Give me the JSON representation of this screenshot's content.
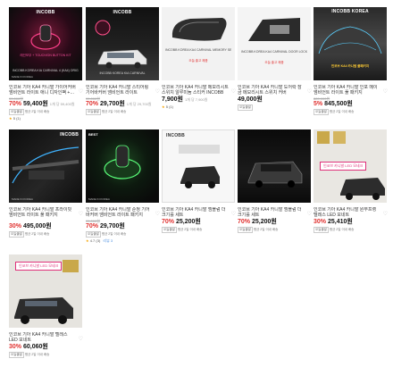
{
  "products": [
    {
      "logo": "INCOBB",
      "banner": "INCOBB KOREA KIA CARNIVAL 4 (KA4) ORIGINAL DESIGN GROUNDS PATTERN AMBIENT LIGHT",
      "highlight": "레인보우 + TOUCH/ON BUTTON KIT",
      "made": "MADE IN KOREA",
      "title": "인코브 기아 KA4 카니발 가이어커버 앰비언트 라이트 애니 디자인팩 +…",
      "original": "99,000원",
      "discount": "70%",
      "price": "59,400",
      "unit": "원",
      "unit_price": "1개 당 59,400원",
      "tag": "오늘출발",
      "shipping": "평균 2일 이내 배송",
      "rating": "5",
      "reviews": "(1)",
      "badge": ""
    },
    {
      "logo": "INCOBB",
      "banner": "INCOBB KOREA KIA CARNIVAL",
      "highlight": "",
      "made": "",
      "title": "인코브 기아 KA4 카니발 스티어링 기어바커버 앰비언트 라이트",
      "original": "99,000원",
      "discount": "70%",
      "price": "29,700",
      "unit": "원",
      "unit_price": "1개 당 29,700원",
      "tag": "오늘출발",
      "shipping": "평균 2일 이내 배송",
      "rating": "",
      "reviews": "",
      "badge": ""
    },
    {
      "logo": "",
      "banner": "INCOBB KOREA KA4 CARNIVAL MEMORY SEAT SWITCH COVER",
      "highlight": "오늘 출고 제품",
      "made": "",
      "title": "인코브 기아 KA4 카니발 메모리시트 스위치 알루미늄 스티커 INCOBB KOREA -…",
      "original": "",
      "discount": "",
      "price": "7,900",
      "unit": "원",
      "unit_price": "1개 당 7,900원",
      "tag": "",
      "shipping": "",
      "rating": "5",
      "reviews": "(1)",
      "badge": ""
    },
    {
      "logo": "",
      "banner": "INCOBB KOREA KA4 CARNIVAL DOOR LOCK SWITCH COVER",
      "highlight": "오늘 출고 제품",
      "made": "",
      "title": "인코브 기아 KA4 카니발 도어락 잠금 메모리시트 스위치 커버 INCOBB…",
      "original": "",
      "discount": "",
      "price": "49,000",
      "unit": "원",
      "unit_price": "",
      "tag": "오늘출발",
      "shipping": "",
      "rating": "",
      "reviews": "",
      "badge": ""
    },
    {
      "logo": "INCOBB KOREA",
      "banner": "인코브 KA4 카니발 풀패키지",
      "highlight": "인코브 KA4 카니발 풀패키지",
      "made": "",
      "title": "인코브 기아 KA4 카니발 인포 메이 앰비언트 라이트 풀 패키지",
      "original": "889,000원",
      "discount": "5%",
      "price": "845,500",
      "unit": "원",
      "unit_price": "",
      "tag": "오늘출발",
      "shipping": "평균 2일 이내 배송",
      "rating": "",
      "reviews": "",
      "badge": ""
    },
    {
      "logo": "INCOBB",
      "banner": "",
      "highlight": "",
      "made": "MADE IN KOREA",
      "title": "인코브 기아 KA4 카니발 프라이빗 앰비언트 라이트 풀 패키지",
      "original": "",
      "discount": "30%",
      "price": "495,000",
      "unit": "원",
      "unit_price": "",
      "tag": "오늘출발",
      "shipping": "평균 2일 이내 배송",
      "rating": "",
      "reviews": "",
      "badge": ""
    },
    {
      "logo": "",
      "banner": "",
      "highlight": "",
      "made": "MADE IN KOREA",
      "title": "인코브 기아 KA4 카니발 순정 기어바커버 앰비언트 라이트 패키지",
      "original": "99,000원",
      "discount": "70%",
      "price": "29,700",
      "unit": "원",
      "unit_price": "",
      "tag": "오늘출발",
      "shipping": "평균 2일 이내 배송",
      "rating": "4.7",
      "reviews": "(3)",
      "badge": "리뷰 3"
    },
    {
      "logo": "INCOBB",
      "banner": "",
      "highlight": "",
      "made": "",
      "title": "인코브 기아 KA4 카니발 엠블럼 더크기를 세트",
      "original": "",
      "discount": "70%",
      "price": "25,200",
      "unit": "원",
      "unit_price": "",
      "tag": "오늘출발",
      "shipping": "평균 2일 이내 배송",
      "rating": "",
      "reviews": "",
      "badge": ""
    },
    {
      "logo": "",
      "banner": "",
      "highlight": "",
      "made": "",
      "title": "인코브 기아 KA4 카니발 엠블럼 더크기를 세트",
      "original": "",
      "discount": "70%",
      "price": "25,200",
      "unit": "원",
      "unit_price": "",
      "tag": "오늘출발",
      "shipping": "평균 2일 이내 배송",
      "rating": "",
      "reviews": "",
      "badge": ""
    },
    {
      "logo": "",
      "banner": "",
      "highlight": "인코브 카니발 LED 모네크",
      "made": "",
      "title": "인코브 기아 KA4 카니발 원무프렝 텔레스 LED 모네트",
      "original": "",
      "discount": "30%",
      "price": "25,410",
      "unit": "원",
      "unit_price": "",
      "tag": "오늘출발",
      "shipping": "평균 2일 이내 배송",
      "rating": "",
      "reviews": "",
      "badge": ""
    },
    {
      "logo": "",
      "banner": "",
      "highlight": "인코브 카니발 LED 모네크",
      "made": "",
      "title": "인코브 기아 KA4 카니발 텔레스 LED 모네트",
      "original": "",
      "discount": "30%",
      "price": "60,060",
      "unit": "원",
      "unit_price": "",
      "tag": "오늘출발",
      "shipping": "평균 2일 이내 배송",
      "rating": "",
      "reviews": "",
      "badge": ""
    }
  ]
}
